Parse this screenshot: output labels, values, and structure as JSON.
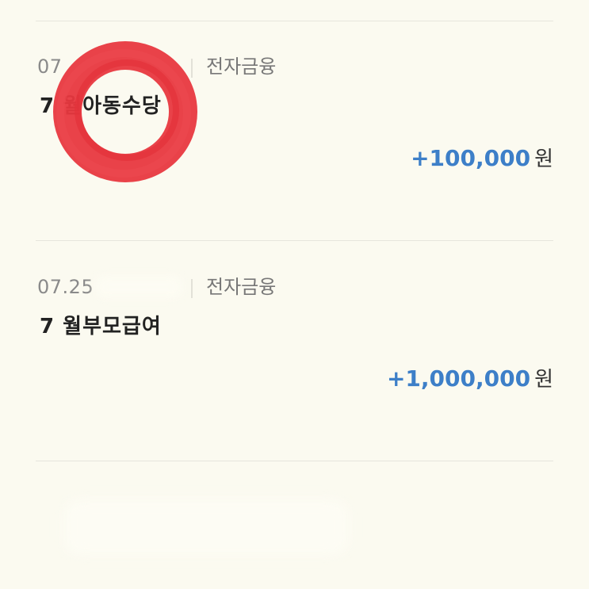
{
  "transactions": [
    {
      "date": "07",
      "category": "전자금융",
      "title": "7 월아동수당",
      "amount": "+100,000",
      "unit": "원"
    },
    {
      "date": "07.25",
      "category": "전자금융",
      "title": "7 월부모급여",
      "amount": "+1,000,000",
      "unit": "원"
    }
  ],
  "colors": {
    "background": "#fbfaf0",
    "amount": "#3d7fc8",
    "divider": "#e6e5dd",
    "marker": "#e8383f"
  }
}
